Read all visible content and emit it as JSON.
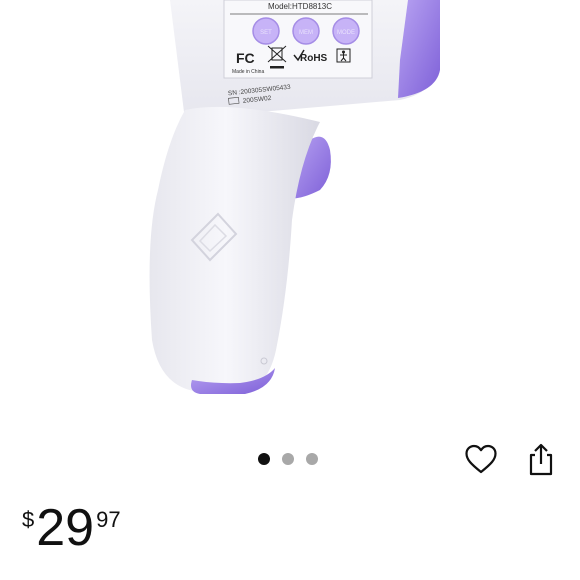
{
  "product": {
    "model_label": "Model:HTD8813C",
    "fc_mark": "FC",
    "made_in": "Made in China",
    "rohs_mark": "RoHS",
    "serial": "SN :200305SW05433",
    "lot": "200SW02",
    "button_labels": [
      "SET",
      "MEM",
      "MODE"
    ],
    "accent_color": "#9b82e6"
  },
  "carousel": {
    "total": 3,
    "active_index": 0
  },
  "actions": {
    "wishlist_icon": "heart-icon",
    "share_icon": "share-icon"
  },
  "price": {
    "currency_symbol": "$",
    "whole": "29",
    "fraction": "97"
  }
}
